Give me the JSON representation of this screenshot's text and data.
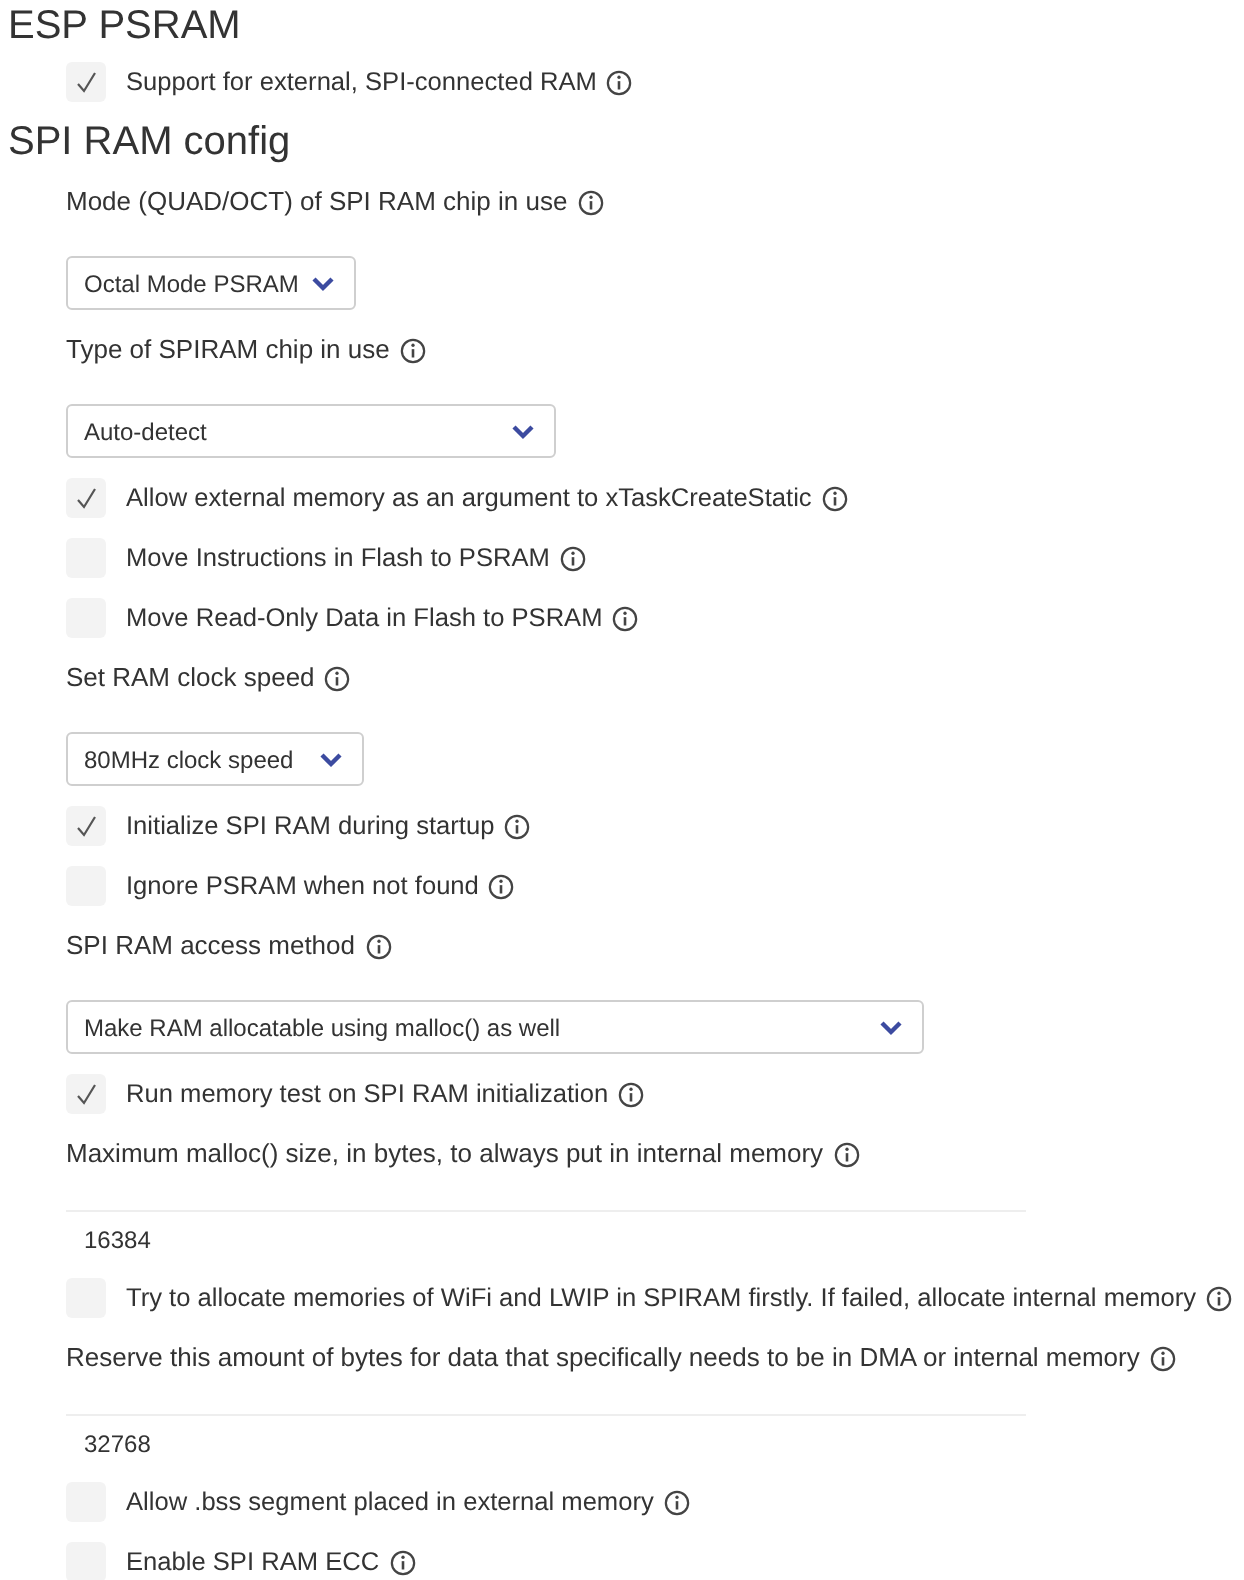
{
  "sections": [
    {
      "title": "ESP PSRAM",
      "items": [
        {
          "kind": "checkbox",
          "label": "Support for external, SPI-connected RAM",
          "checked": true
        }
      ]
    },
    {
      "title": "SPI RAM config",
      "items": [
        {
          "kind": "select",
          "label": "Mode (QUAD/OCT) of SPI RAM chip in use",
          "value": "Octal Mode PSRAM"
        },
        {
          "kind": "select",
          "label": "Type of SPIRAM chip in use",
          "value": "Auto-detect"
        },
        {
          "kind": "checkbox",
          "label": "Allow external memory as an argument to xTaskCreateStatic",
          "checked": true
        },
        {
          "kind": "checkbox",
          "label": "Move Instructions in Flash to PSRAM",
          "checked": false
        },
        {
          "kind": "checkbox",
          "label": "Move Read-Only Data in Flash to PSRAM",
          "checked": false
        },
        {
          "kind": "select",
          "label": "Set RAM clock speed",
          "value": "80MHz clock speed"
        },
        {
          "kind": "checkbox",
          "label": "Initialize SPI RAM during startup",
          "checked": true
        },
        {
          "kind": "checkbox",
          "label": "Ignore PSRAM when not found",
          "checked": false
        },
        {
          "kind": "select",
          "label": "SPI RAM access method",
          "value": "Make RAM allocatable using malloc() as well"
        },
        {
          "kind": "checkbox",
          "label": "Run memory test on SPI RAM initialization",
          "checked": true
        },
        {
          "kind": "number",
          "label": "Maximum malloc() size, in bytes, to always put in internal memory",
          "value": "16384"
        },
        {
          "kind": "checkbox",
          "label": "Try to allocate memories of WiFi and LWIP in SPIRAM firstly. If failed, allocate internal memory",
          "checked": false
        },
        {
          "kind": "number",
          "label": "Reserve this amount of bytes for data that specifically needs to be in DMA or internal memory",
          "value": "32768"
        },
        {
          "kind": "checkbox",
          "label": "Allow .bss segment placed in external memory",
          "checked": false
        },
        {
          "kind": "checkbox",
          "label": "Enable SPI RAM ECC",
          "checked": false
        }
      ]
    }
  ]
}
